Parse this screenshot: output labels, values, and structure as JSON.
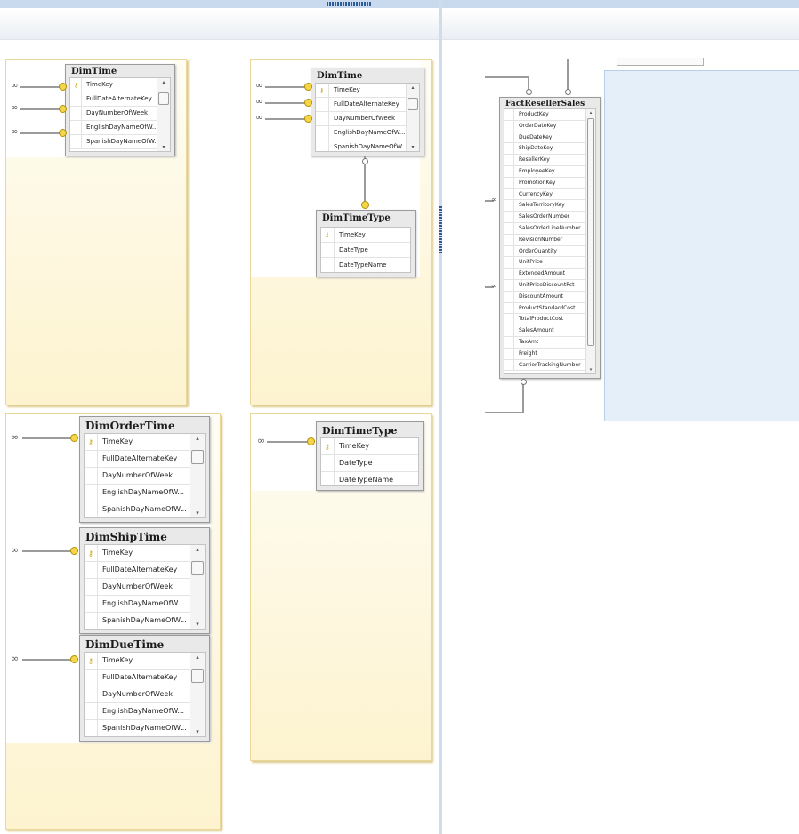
{
  "left_view": {
    "dim_time_1": {
      "title": "DimTime",
      "rows": [
        "TimeKey",
        "FullDateAlternateKey",
        "DayNumberOfWeek",
        "EnglishDayNameOfW...",
        "SpanishDayNameOfW..."
      ]
    },
    "dim_time_2": {
      "title": "DimTime",
      "rows": [
        "TimeKey",
        "FullDateAlternateKey",
        "DayNumberOfWeek",
        "EnglishDayNameOfW...",
        "SpanishDayNameOfW..."
      ]
    },
    "dim_time_type_1": {
      "title": "DimTimeType",
      "rows": [
        "TimeKey",
        "DateType",
        "DateTypeName"
      ]
    },
    "dim_order_time": {
      "title": "DimOrderTime",
      "rows": [
        "TimeKey",
        "FullDateAlternateKey",
        "DayNumberOfWeek",
        "EnglishDayNameOfW...",
        "SpanishDayNameOfW..."
      ]
    },
    "dim_ship_time": {
      "title": "DimShipTime",
      "rows": [
        "TimeKey",
        "FullDateAlternateKey",
        "DayNumberOfWeek",
        "EnglishDayNameOfW...",
        "SpanishDayNameOfW..."
      ]
    },
    "dim_due_time": {
      "title": "DimDueTime",
      "rows": [
        "TimeKey",
        "FullDateAlternateKey",
        "DayNumberOfWeek",
        "EnglishDayNameOfW...",
        "SpanishDayNameOfW..."
      ]
    },
    "dim_time_type_2": {
      "title": "DimTimeType",
      "rows": [
        "TimeKey",
        "DateType",
        "DateTypeName"
      ]
    }
  },
  "right_view": {
    "fact_reseller_sales": {
      "title": "FactResellerSales",
      "rows": [
        "ProductKey",
        "OrderDateKey",
        "DueDateKey",
        "ShipDateKey",
        "ResellerKey",
        "EmployeeKey",
        "PromotionKey",
        "CurrencyKey",
        "SalesTerritoryKey",
        "SalesOrderNumber",
        "SalesOrderLineNumber",
        "RevisionNumber",
        "OrderQuantity",
        "UnitPrice",
        "ExtendedAmount",
        "UnitPriceDiscountPct",
        "DiscountAmount",
        "ProductStandardCost",
        "TotalProductCost",
        "SalesAmount",
        "TaxAmt",
        "Freight",
        "CarrierTrackingNumber"
      ]
    }
  },
  "icons": {
    "key": "key-icon",
    "many": "infinity-icon",
    "one": "key-connector-icon",
    "scroll_up": "chevron-up-icon",
    "scroll_down": "chevron-down-icon"
  },
  "colors": {
    "panel_top": "#fffdf4",
    "panel_bottom": "#fdf3cf",
    "selection_blue": "#e4effa",
    "key_gold": "#c9a000"
  }
}
